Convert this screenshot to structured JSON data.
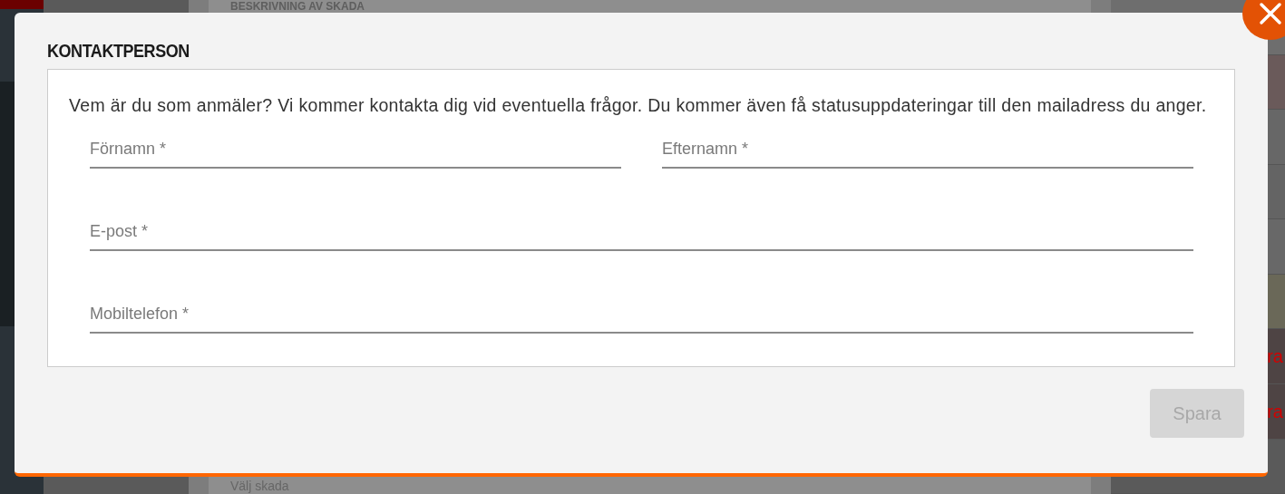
{
  "background": {
    "heading": "BESKRIVNING AV SKADA",
    "select_placeholder": "Välj skada",
    "side_labels": [
      "ra",
      "ra"
    ]
  },
  "dialog": {
    "title": "KONTAKTPERSON",
    "intro": "Vem är du som anmäler? Vi kommer kontakta dig vid eventuella frågor. Du kommer även få statusuppdateringar till den mailadress du anger.",
    "fields": [
      {
        "kind": "half",
        "placeholder": "Förnamn *"
      },
      {
        "kind": "half",
        "placeholder": "Efternamn *"
      },
      {
        "kind": "full",
        "placeholder": "E-post *"
      },
      {
        "kind": "full",
        "placeholder": "Mobiltelefon *"
      }
    ],
    "save_button": {
      "label": "Spara",
      "disabled": true
    }
  }
}
